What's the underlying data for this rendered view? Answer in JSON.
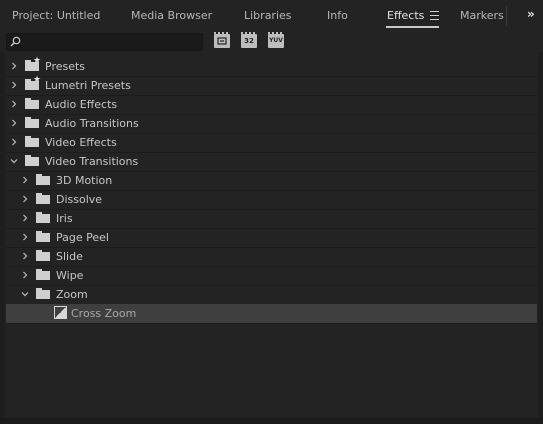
{
  "tabs": [
    {
      "label": "Project: Untitled",
      "active": false
    },
    {
      "label": "Media Browser",
      "active": false
    },
    {
      "label": "Libraries",
      "active": false
    },
    {
      "label": "Info",
      "active": false
    },
    {
      "label": "Effects",
      "active": true
    },
    {
      "label": "Markers",
      "active": false
    }
  ],
  "overflow_label": "»",
  "search": {
    "value": "",
    "placeholder": "",
    "icon": "search-icon"
  },
  "filter_buttons": [
    {
      "label": "",
      "icon": "accelerated-effects-icon"
    },
    {
      "label": "32",
      "icon": "32-bit-effects-icon"
    },
    {
      "label": "YUV",
      "icon": "yuv-effects-icon"
    }
  ],
  "tree": [
    {
      "label": "Presets",
      "depth": 0,
      "expanded": false,
      "kind": "preset-folder"
    },
    {
      "label": "Lumetri Presets",
      "depth": 0,
      "expanded": false,
      "kind": "preset-folder"
    },
    {
      "label": "Audio Effects",
      "depth": 0,
      "expanded": false,
      "kind": "folder"
    },
    {
      "label": "Audio Transitions",
      "depth": 0,
      "expanded": false,
      "kind": "folder"
    },
    {
      "label": "Video Effects",
      "depth": 0,
      "expanded": false,
      "kind": "folder"
    },
    {
      "label": "Video Transitions",
      "depth": 0,
      "expanded": true,
      "kind": "folder"
    },
    {
      "label": "3D Motion",
      "depth": 1,
      "expanded": false,
      "kind": "folder"
    },
    {
      "label": "Dissolve",
      "depth": 1,
      "expanded": false,
      "kind": "folder"
    },
    {
      "label": "Iris",
      "depth": 1,
      "expanded": false,
      "kind": "folder"
    },
    {
      "label": "Page Peel",
      "depth": 1,
      "expanded": false,
      "kind": "folder"
    },
    {
      "label": "Slide",
      "depth": 1,
      "expanded": false,
      "kind": "folder"
    },
    {
      "label": "Wipe",
      "depth": 1,
      "expanded": false,
      "kind": "folder"
    },
    {
      "label": "Zoom",
      "depth": 1,
      "expanded": true,
      "kind": "folder"
    },
    {
      "label": "Cross Zoom",
      "depth": 2,
      "expanded": false,
      "kind": "effect",
      "selected": true
    }
  ]
}
